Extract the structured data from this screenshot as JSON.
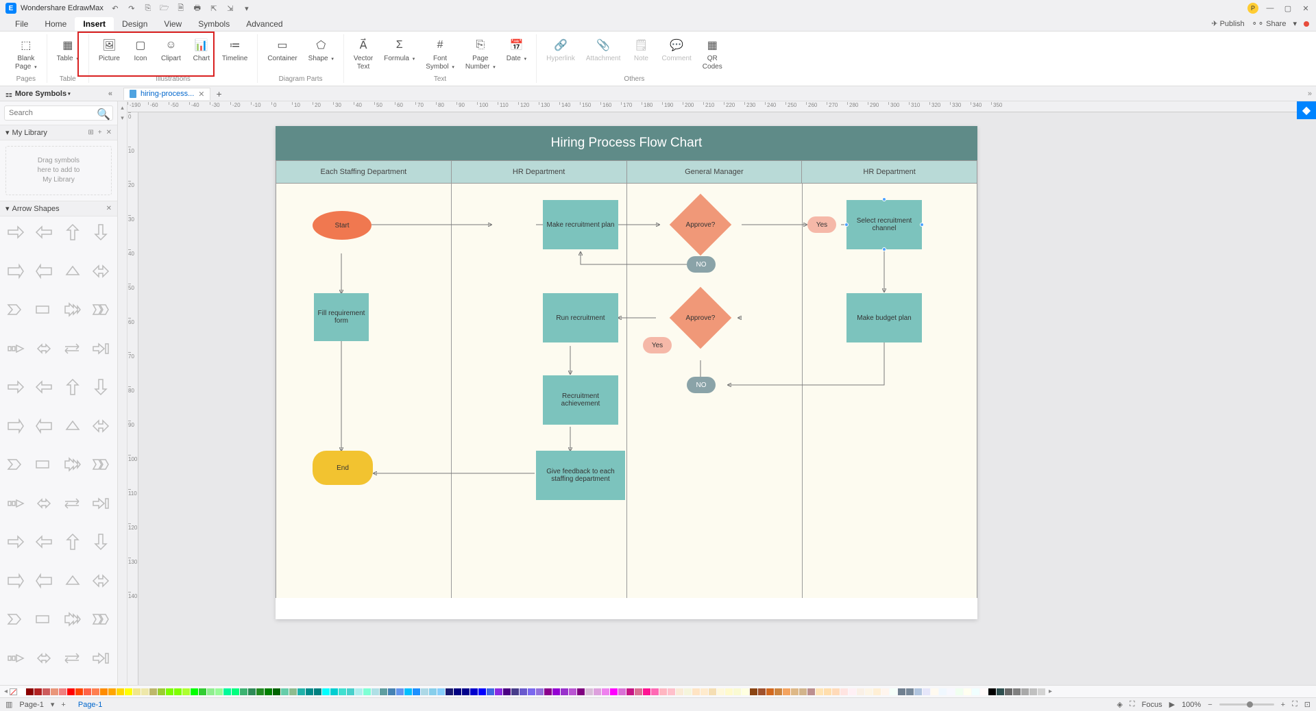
{
  "app": {
    "title": "Wondershare EdrawMax"
  },
  "titleIcons": [
    "↶",
    "↷",
    "⎘",
    "🗁",
    "🗎",
    "🖶",
    "⇱",
    "⇲",
    "▾"
  ],
  "winControls": [
    "—",
    "▢",
    "✕"
  ],
  "menu": [
    "File",
    "Home",
    "Insert",
    "Design",
    "View",
    "Symbols",
    "Advanced"
  ],
  "menuActiveIndex": 2,
  "menuRight": {
    "publish": "Publish",
    "share": "Share"
  },
  "ribbon": {
    "groups": [
      {
        "label": "Pages",
        "items": [
          {
            "icon": "⬚",
            "label": "Blank\nPage",
            "drop": true
          }
        ]
      },
      {
        "label": "Table",
        "items": [
          {
            "icon": "▦",
            "label": "Table",
            "drop": true
          }
        ]
      },
      {
        "label": "Illustrations",
        "items": [
          {
            "icon": "🖼",
            "label": "Picture"
          },
          {
            "icon": "▢",
            "label": "Icon"
          },
          {
            "icon": "☺",
            "label": "Clipart"
          },
          {
            "icon": "📊",
            "label": "Chart"
          },
          {
            "icon": "≔",
            "label": "Timeline"
          }
        ]
      },
      {
        "label": "Diagram Parts",
        "items": [
          {
            "icon": "▭",
            "label": "Container"
          },
          {
            "icon": "⬠",
            "label": "Shape",
            "drop": true
          }
        ]
      },
      {
        "label": "Text",
        "items": [
          {
            "icon": "A⃗",
            "label": "Vector\nText"
          },
          {
            "icon": "Σ",
            "label": "Formula",
            "drop": true
          },
          {
            "icon": "#",
            "label": "Font\nSymbol",
            "drop": true
          },
          {
            "icon": "⎘",
            "label": "Page\nNumber",
            "drop": true
          },
          {
            "icon": "📅",
            "label": "Date",
            "drop": true
          }
        ]
      },
      {
        "label": "Others",
        "items": [
          {
            "icon": "🔗",
            "label": "Hyperlink",
            "disabled": true
          },
          {
            "icon": "📎",
            "label": "Attachment",
            "disabled": true
          },
          {
            "icon": "🗒",
            "label": "Note",
            "disabled": true
          },
          {
            "icon": "💬",
            "label": "Comment",
            "disabled": true
          },
          {
            "icon": "▦",
            "label": "QR\nCodes"
          }
        ]
      }
    ]
  },
  "leftPanel": {
    "header": "More Symbols",
    "searchPlaceholder": "Search",
    "myLibrary": "My Library",
    "myLibraryHint": "Drag symbols\nhere to add to\nMy Library",
    "arrowShapes": "Arrow Shapes"
  },
  "docTab": {
    "name": "hiring-process..."
  },
  "rulerH": [
    -190,
    -60,
    -50,
    -40,
    -30,
    -20,
    -10,
    0,
    10,
    20,
    30,
    40,
    50,
    60,
    70,
    80,
    90,
    100,
    110,
    120,
    130,
    140,
    150,
    160,
    170,
    180,
    190,
    200,
    210,
    220,
    230,
    240,
    250,
    260,
    270,
    280,
    290,
    300,
    310,
    320,
    330,
    340,
    350
  ],
  "rulerV": [
    0,
    10,
    20,
    30,
    40,
    50,
    60,
    70,
    80,
    90,
    100,
    110,
    120,
    130,
    140
  ],
  "flowchart": {
    "title": "Hiring Process Flow Chart",
    "lanes": [
      "Each Staffing Department",
      "HR Department",
      "General Manager",
      "HR Department"
    ],
    "shapes": {
      "start": "Start",
      "fillReq": "Fill requirement\nform",
      "end": "End",
      "makePlan": "Make\nrecruitment\nplan",
      "runRec": "Run\nrecruitment",
      "recAch": "Recruitment\nachievement",
      "feedback": "Give feedback\nto each staffing\ndepartment",
      "approve1": "Approve?",
      "approve2": "Approve?",
      "no1": "NO",
      "no2": "NO",
      "yes1": "Yes",
      "yes2": "Yes",
      "selectCh": "Select\nrecruitment\nchannel",
      "budget": "Make budget\nplan"
    }
  },
  "statusbar": {
    "pageLabel": "Page-1",
    "pageTab": "Page-1",
    "focus": "Focus",
    "zoom": "100%"
  },
  "paletteColors": [
    "#ffffff",
    "#8b0000",
    "#b22222",
    "#cd5c5c",
    "#e9967a",
    "#f08080",
    "#ff0000",
    "#ff4500",
    "#ff6347",
    "#ff7f50",
    "#ff8c00",
    "#ffa500",
    "#ffd700",
    "#ffff00",
    "#f0e68c",
    "#eee8aa",
    "#bdb76b",
    "#9acd32",
    "#7cfc00",
    "#7fff00",
    "#adff2f",
    "#00ff00",
    "#32cd32",
    "#90ee90",
    "#98fb98",
    "#00fa9a",
    "#00ff7f",
    "#3cb371",
    "#2e8b57",
    "#228b22",
    "#008000",
    "#006400",
    "#66cdaa",
    "#8fbc8f",
    "#20b2aa",
    "#008b8b",
    "#008080",
    "#00ffff",
    "#00ced1",
    "#40e0d0",
    "#48d1cc",
    "#afeeee",
    "#7fffd4",
    "#b0e0e6",
    "#5f9ea0",
    "#4682b4",
    "#6495ed",
    "#00bfff",
    "#1e90ff",
    "#add8e6",
    "#87ceeb",
    "#87cefa",
    "#191970",
    "#000080",
    "#00008b",
    "#0000cd",
    "#0000ff",
    "#4169e1",
    "#8a2be2",
    "#4b0082",
    "#483d8b",
    "#6a5acd",
    "#7b68ee",
    "#9370db",
    "#8b008b",
    "#9400d3",
    "#9932cc",
    "#ba55d3",
    "#800080",
    "#d8bfd8",
    "#dda0dd",
    "#ee82ee",
    "#ff00ff",
    "#da70d6",
    "#c71585",
    "#db7093",
    "#ff1493",
    "#ff69b4",
    "#ffb6c1",
    "#ffc0cb",
    "#faebd7",
    "#f5f5dc",
    "#ffe4c4",
    "#ffebcd",
    "#f5deb3",
    "#fff8dc",
    "#fffacd",
    "#fafad2",
    "#ffffe0",
    "#8b4513",
    "#a0522d",
    "#d2691e",
    "#cd853f",
    "#f4a460",
    "#deb887",
    "#d2b48c",
    "#bc8f8f",
    "#ffe4b5",
    "#ffdead",
    "#ffdab9",
    "#ffe4e1",
    "#fff0f5",
    "#faf0e6",
    "#fdf5e6",
    "#ffefd5",
    "#fff5ee",
    "#f5fffa",
    "#708090",
    "#778899",
    "#b0c4de",
    "#e6e6fa",
    "#fffaf0",
    "#f0f8ff",
    "#f8f8ff",
    "#f0fff0",
    "#fffff0",
    "#f0ffff",
    "#fffafa",
    "#000000",
    "#2f4f4f",
    "#696969",
    "#808080",
    "#a9a9a9",
    "#c0c0c0",
    "#d3d3d3"
  ]
}
